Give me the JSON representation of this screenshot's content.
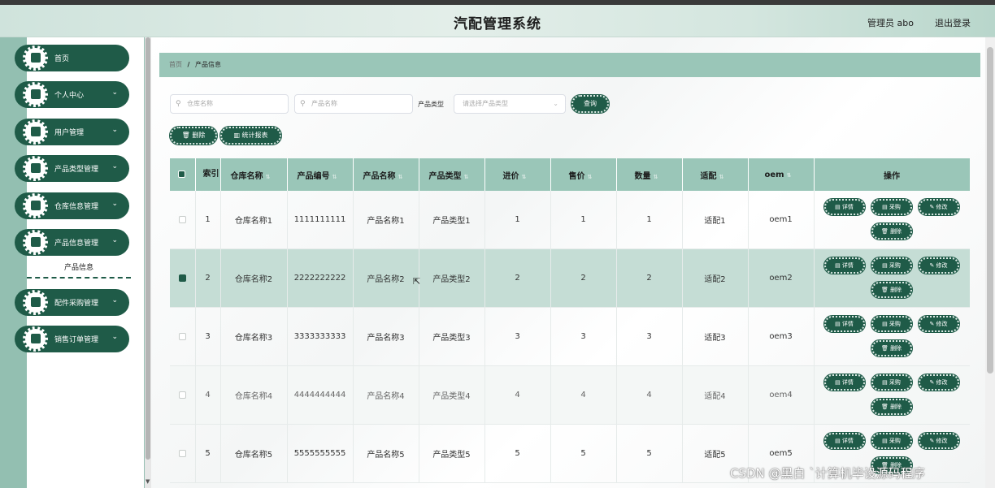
{
  "header": {
    "title": "汽配管理系统",
    "user": "管理员 abo",
    "logout": "退出登录"
  },
  "sidebar": {
    "items": [
      {
        "label": "首页",
        "has_chevron": false
      },
      {
        "label": "个人中心",
        "has_chevron": true
      },
      {
        "label": "用户管理",
        "has_chevron": true
      },
      {
        "label": "产品类型管理",
        "has_chevron": true
      },
      {
        "label": "仓库信息管理",
        "has_chevron": true
      },
      {
        "label": "产品信息管理",
        "has_chevron": true
      },
      {
        "label": "配件采购管理",
        "has_chevron": true
      },
      {
        "label": "销售订单管理",
        "has_chevron": true
      }
    ],
    "sub_item": "产品信息",
    "chevron": "⌄"
  },
  "breadcrumb": {
    "home": "首页",
    "separator": "/",
    "current": "产品信息"
  },
  "filters": {
    "warehouse_placeholder": "仓库名称",
    "product_placeholder": "产品名称",
    "type_label": "产品类型",
    "type_placeholder": "请选择产品类型",
    "query_button": "查询"
  },
  "actions": {
    "delete": "删除",
    "report": "统计报表"
  },
  "table": {
    "columns": [
      "索引",
      "仓库名称",
      "产品编号",
      "产品名称",
      "产品类型",
      "进价",
      "售价",
      "数量",
      "适配",
      "oem",
      "操作"
    ],
    "rows": [
      {
        "index": "1",
        "warehouse": "仓库名称1",
        "code": "1111111111",
        "name": "产品名称1",
        "type": "产品类型1",
        "cost": "1",
        "price": "1",
        "qty": "1",
        "fit": "适配1",
        "oem": "oem1"
      },
      {
        "index": "2",
        "warehouse": "仓库名称2",
        "code": "2222222222",
        "name": "产品名称2",
        "type": "产品类型2",
        "cost": "2",
        "price": "2",
        "qty": "2",
        "fit": "适配2",
        "oem": "oem2"
      },
      {
        "index": "3",
        "warehouse": "仓库名称3",
        "code": "3333333333",
        "name": "产品名称3",
        "type": "产品类型3",
        "cost": "3",
        "price": "3",
        "qty": "3",
        "fit": "适配3",
        "oem": "oem3"
      },
      {
        "index": "4",
        "warehouse": "仓库名称4",
        "code": "4444444444",
        "name": "产品名称4",
        "type": "产品类型4",
        "cost": "4",
        "price": "4",
        "qty": "4",
        "fit": "适配4",
        "oem": "oem4"
      },
      {
        "index": "5",
        "warehouse": "仓库名称5",
        "code": "5555555555",
        "name": "产品名称5",
        "type": "产品类型5",
        "cost": "5",
        "price": "5",
        "qty": "5",
        "fit": "适配5",
        "oem": "oem5"
      }
    ],
    "row_buttons": {
      "detail": "详情",
      "purchase": "采购",
      "edit": "修改",
      "delete": "删除"
    }
  },
  "watermark": "CSDN @黑白 `计算机毕设源码程序",
  "colors": {
    "accent": "#1f5b48",
    "table_header": "#9ac6b8",
    "sidebar": "#93bfb1"
  }
}
